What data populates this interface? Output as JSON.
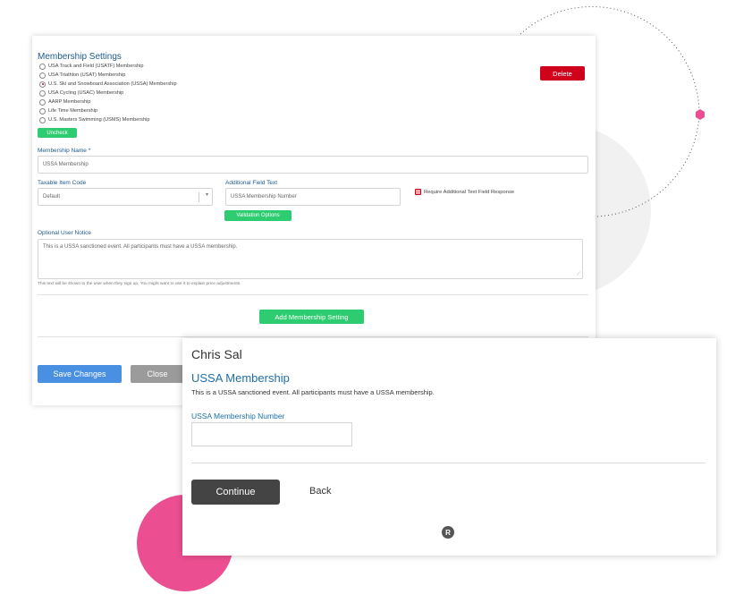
{
  "settings": {
    "title": "Membership Settings",
    "options": [
      {
        "label": "USA Track and Field (USATF) Membership",
        "selected": false
      },
      {
        "label": "USA Triathlon (USAT) Membership",
        "selected": false
      },
      {
        "label": "U.S. Ski and Snowboard Association (USSA) Membership",
        "selected": true
      },
      {
        "label": "USA Cycling (USAC) Membership",
        "selected": false
      },
      {
        "label": "AARP Membership",
        "selected": false
      },
      {
        "label": "Life Time Membership",
        "selected": false
      },
      {
        "label": "U.S. Masters Swimming (USMS) Membership",
        "selected": false
      }
    ],
    "delete_label": "Delete",
    "uncheck_label": "Uncheck",
    "membership_name_label": "Membership Name *",
    "membership_name_value": "USSA Membership",
    "taxable_label": "Taxable Item Code",
    "taxable_value": "Default",
    "additional_field_label": "Additional Field Text",
    "additional_field_value": "USSA Membership Number",
    "validation_label": "Validation Options",
    "require_label": "Require Additional Text Field Response",
    "notice_label": "Optional User Notice",
    "notice_value": "This is a USSA sanctioned event. All participants must have a USSA membership.",
    "notice_help": "This text will be shown to the user when they sign up. You might want to use it to explain price adjustments.",
    "add_setting_label": "Add Membership Setting",
    "save_label": "Save Changes",
    "close_label": "Close"
  },
  "modal": {
    "user_name": "Chris Sal",
    "title": "USSA Membership",
    "description": "This is a USSA sanctioned event. All participants must have a USSA membership.",
    "field_label": "USSA Membership Number",
    "field_value": "",
    "continue_label": "Continue",
    "back_label": "Back",
    "logo_letter": "R"
  },
  "colors": {
    "accent_blue": "#1e5a8c",
    "green": "#2ecc71",
    "red": "#d0021b",
    "pink": "#ec4f91",
    "save_blue": "#4a90e2"
  }
}
